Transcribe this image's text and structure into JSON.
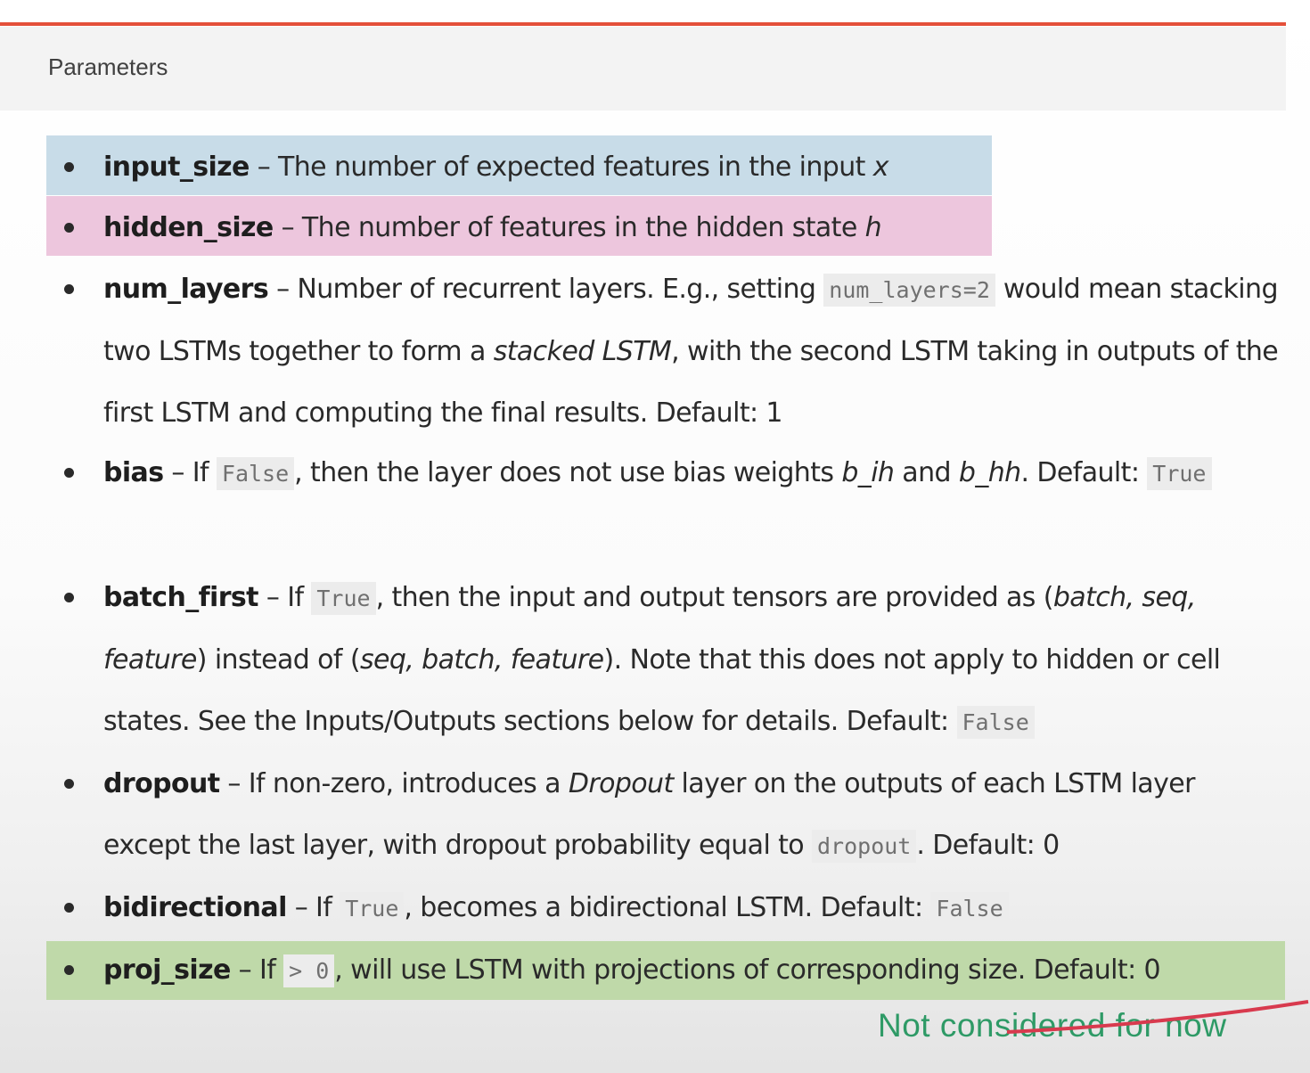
{
  "header": {
    "title": "Parameters"
  },
  "params": [
    {
      "name": "input_size",
      "parts": [
        {
          "t": " – The number of expected features in the input "
        },
        {
          "i": "x"
        }
      ]
    },
    {
      "name": "hidden_size",
      "parts": [
        {
          "t": " – The number of features in the hidden state "
        },
        {
          "i": "h"
        }
      ]
    },
    {
      "name": "num_layers",
      "parts": [
        {
          "t": " – Number of recurrent layers. E.g., setting "
        },
        {
          "c": "num_layers=2"
        },
        {
          "t": " would mean stacking two LSTMs together to form a "
        },
        {
          "i": "stacked LSTM"
        },
        {
          "t": ", with the second LSTM taking in outputs of the first LSTM and computing the final results. Default: 1"
        }
      ]
    },
    {
      "name": "bias",
      "parts": [
        {
          "t": " – If "
        },
        {
          "c": "False"
        },
        {
          "t": ", then the layer does not use bias weights "
        },
        {
          "i": "b_ih"
        },
        {
          "t": " and "
        },
        {
          "i": "b_hh"
        },
        {
          "t": ". Default: "
        },
        {
          "c": "True"
        }
      ]
    },
    {
      "name": "batch_first",
      "parts": [
        {
          "t": " – If "
        },
        {
          "c": "True"
        },
        {
          "t": ", then the input and output tensors are provided as ("
        },
        {
          "i": "batch, seq, feature"
        },
        {
          "t": ") instead of ("
        },
        {
          "i": "seq, batch, feature"
        },
        {
          "t": "). Note that this does not apply to hidden or cell states. See the Inputs/Outputs sections below for details. Default: "
        },
        {
          "c": "False"
        }
      ]
    },
    {
      "name": "dropout",
      "parts": [
        {
          "t": " – If non-zero, introduces a "
        },
        {
          "i": "Dropout"
        },
        {
          "t": " layer on the outputs of each LSTM layer except the last layer, with dropout probability equal to "
        },
        {
          "c": "dropout"
        },
        {
          "t": ". Default: 0"
        }
      ]
    },
    {
      "name": "bidirectional",
      "parts": [
        {
          "t": " – If "
        },
        {
          "c": "True"
        },
        {
          "t": ", becomes a bidirectional LSTM. Default: "
        },
        {
          "c": "False"
        }
      ]
    },
    {
      "name": "proj_size",
      "parts": [
        {
          "t": " – If "
        },
        {
          "c": "> 0"
        },
        {
          "t": ", will use LSTM with projections of corresponding size. Default: 0"
        }
      ]
    }
  ],
  "annotation": {
    "text": "Not considered for now",
    "color": "#2e9a66"
  },
  "colors": {
    "accent_rule": "#e4503a",
    "highlight_input": "#c8dce8",
    "highlight_hidden": "#edc6dd",
    "highlight_proj": "#bfd9a9"
  }
}
